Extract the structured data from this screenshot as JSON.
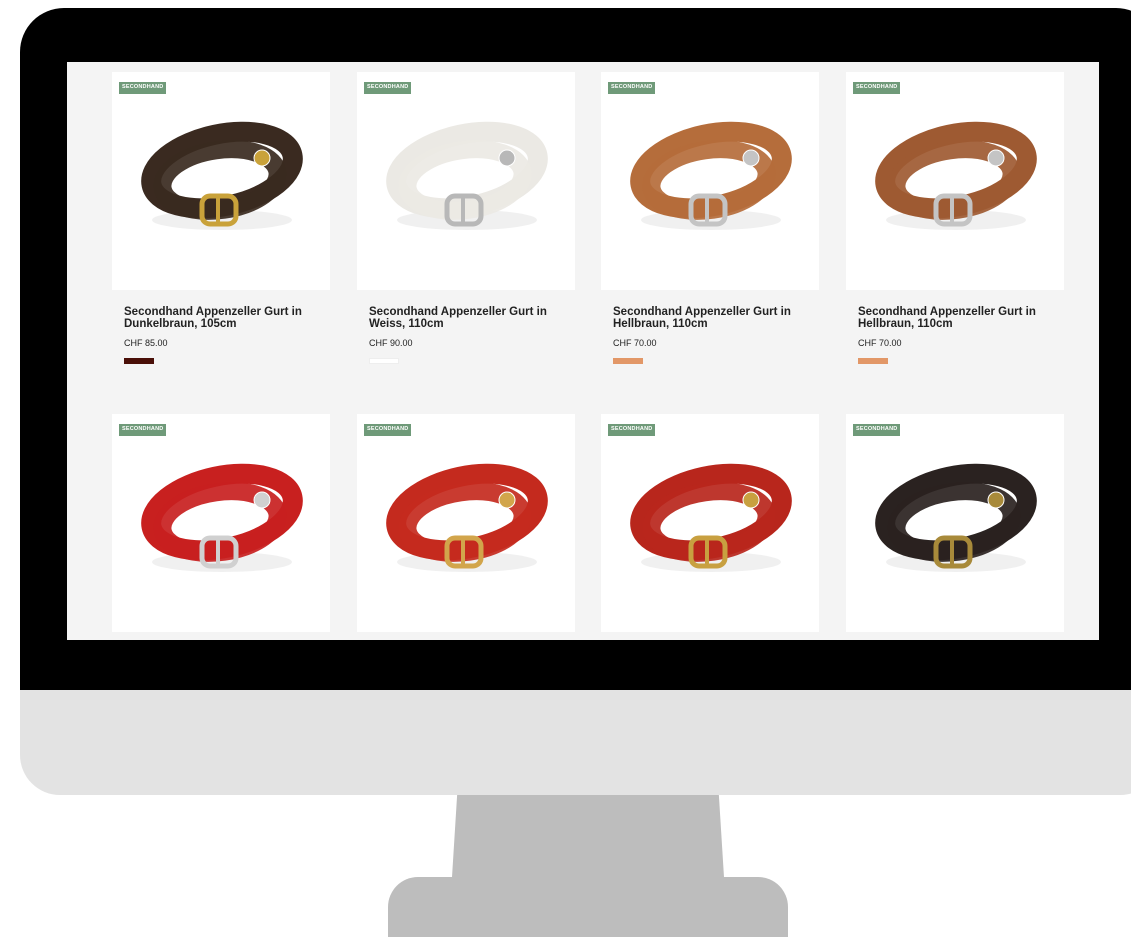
{
  "badge_label": "SECONDHAND",
  "products": [
    {
      "title": "Secondhand Appenzeller Gurt in Dunkelbraun, 105cm",
      "price": "CHF 85.00",
      "swatch": "#4a0f08",
      "leather": "#3a2a20",
      "hardware": "#c9a23a",
      "image": "belt-dark-brown-brass"
    },
    {
      "title": "Secondhand Appenzeller Gurt in Weiss, 110cm",
      "price": "CHF 90.00",
      "swatch": "#ffffff",
      "leather": "#ebe9e4",
      "hardware": "#b8b8b8",
      "image": "belt-white-silver"
    },
    {
      "title": "Secondhand Appenzeller Gurt in Hellbraun, 110cm",
      "price": "CHF 70.00",
      "swatch": "#e29767",
      "leather": "#b56d3b",
      "hardware": "#c4c4c4",
      "image": "belt-light-brown-silver"
    },
    {
      "title": "Secondhand Appenzeller Gurt in Hellbraun, 110cm",
      "price": "CHF 70.00",
      "swatch": "#e29767",
      "leather": "#9e5a32",
      "hardware": "#c4c4c4",
      "image": "belt-light-brown-silver"
    },
    {
      "leather": "#c8201f",
      "hardware": "#d0d0d0",
      "image": "belt-red-silver"
    },
    {
      "leather": "#c42a1e",
      "hardware": "#d2a54b",
      "image": "belt-red-brass"
    },
    {
      "leather": "#b8261c",
      "hardware": "#c8a040",
      "image": "belt-red-brass"
    },
    {
      "leather": "#2a2220",
      "hardware": "#a88a3a",
      "image": "belt-black-brass"
    }
  ]
}
